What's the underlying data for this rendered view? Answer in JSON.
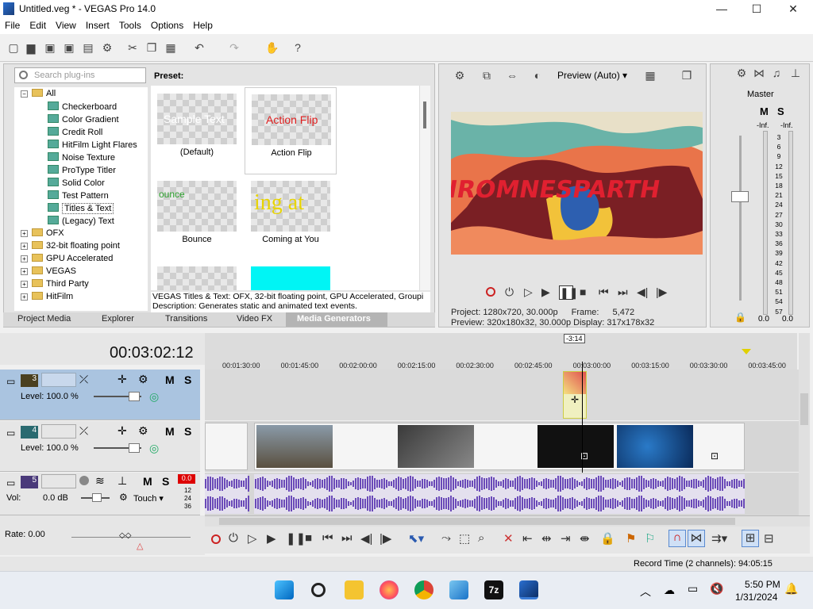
{
  "window": {
    "title": "Untitled.veg * - VEGAS Pro 14.0",
    "minimize": "—",
    "maximize": "☐",
    "close": "✕"
  },
  "menu": [
    "File",
    "Edit",
    "View",
    "Insert",
    "Tools",
    "Options",
    "Help"
  ],
  "plugins": {
    "search_placeholder": "Search plug-ins",
    "tree": {
      "all": "All",
      "items": [
        "Checkerboard",
        "Color Gradient",
        "Credit Roll",
        "HitFilm Light Flares",
        "Noise Texture",
        "ProType Titler",
        "Solid Color",
        "Test Pattern",
        "Titles & Text",
        "(Legacy) Text"
      ],
      "folders": [
        "OFX",
        "32-bit floating point",
        "GPU Accelerated",
        "VEGAS",
        "Third Party",
        "HitFilm"
      ]
    },
    "preset_label": "Preset:",
    "presets": [
      {
        "label": "(Default)",
        "sample": "Sample Text"
      },
      {
        "label": "Action Flip",
        "sample": "Action Flip"
      },
      {
        "label": "Bounce",
        "sample": "ounce"
      },
      {
        "label": "Coming at You",
        "sample": "ing at"
      }
    ],
    "description": "VEGAS Titles & Text: OFX, 32-bit floating point, GPU Accelerated, Groupi",
    "description2": "Description: Generates static and animated text events.",
    "tabs": [
      "Project Media",
      "Explorer",
      "Transitions",
      "Video FX",
      "Media Generators"
    ]
  },
  "preview": {
    "mode": "Preview (Auto)",
    "project_label": "Project:",
    "project_value": "1280x720, 30.000p",
    "preview_label": "Preview:",
    "preview_value": "320x180x32, 30.000p",
    "frame_label": "Frame:",
    "frame_value": "5,472",
    "display_label": "Display:",
    "display_value": "317x178x32",
    "overlay_text": "HROMNESPARTH"
  },
  "master": {
    "label": "Master",
    "m": "M",
    "s": "S",
    "inf_left": "-Inf.",
    "inf_right": "-Inf.",
    "scale": [
      "3",
      "6",
      "9",
      "12",
      "15",
      "18",
      "21",
      "24",
      "27",
      "30",
      "33",
      "36",
      "39",
      "42",
      "45",
      "48",
      "51",
      "54",
      "57"
    ],
    "bottom_left": "0.0",
    "bottom_right": "0.0"
  },
  "timeline": {
    "time": "00:03:02:12",
    "marker": "-3:14",
    "ticks": [
      "00:01:30:00",
      "00:01:45:00",
      "00:02:00:00",
      "00:02:15:00",
      "00:02:30:00",
      "00:02:45:00",
      "00:03:00:00",
      "00:03:15:00",
      "00:03:30:00",
      "00:03:45:00"
    ],
    "tracks": [
      {
        "num": "3",
        "level": "Level: 100.0 %",
        "m": "M",
        "s": "S"
      },
      {
        "num": "4",
        "level": "Level: 100.0 %",
        "m": "M",
        "s": "S"
      },
      {
        "num": "5",
        "vol": "Vol:",
        "vol_value": "0.0 dB",
        "touch": "Touch",
        "m": "M",
        "s": "S",
        "peak": "0.0",
        "meter": [
          "12",
          "24",
          "36"
        ]
      }
    ],
    "rate": "Rate: 0.00"
  },
  "status": "Record Time (2 channels): 94:05:15",
  "taskbar": {
    "time": "5:50 PM",
    "date": "1/31/2024"
  },
  "colors": {
    "accent": "#3c78d8",
    "audio": "#6a4ab8",
    "video_bg": "#f5f5f5"
  }
}
